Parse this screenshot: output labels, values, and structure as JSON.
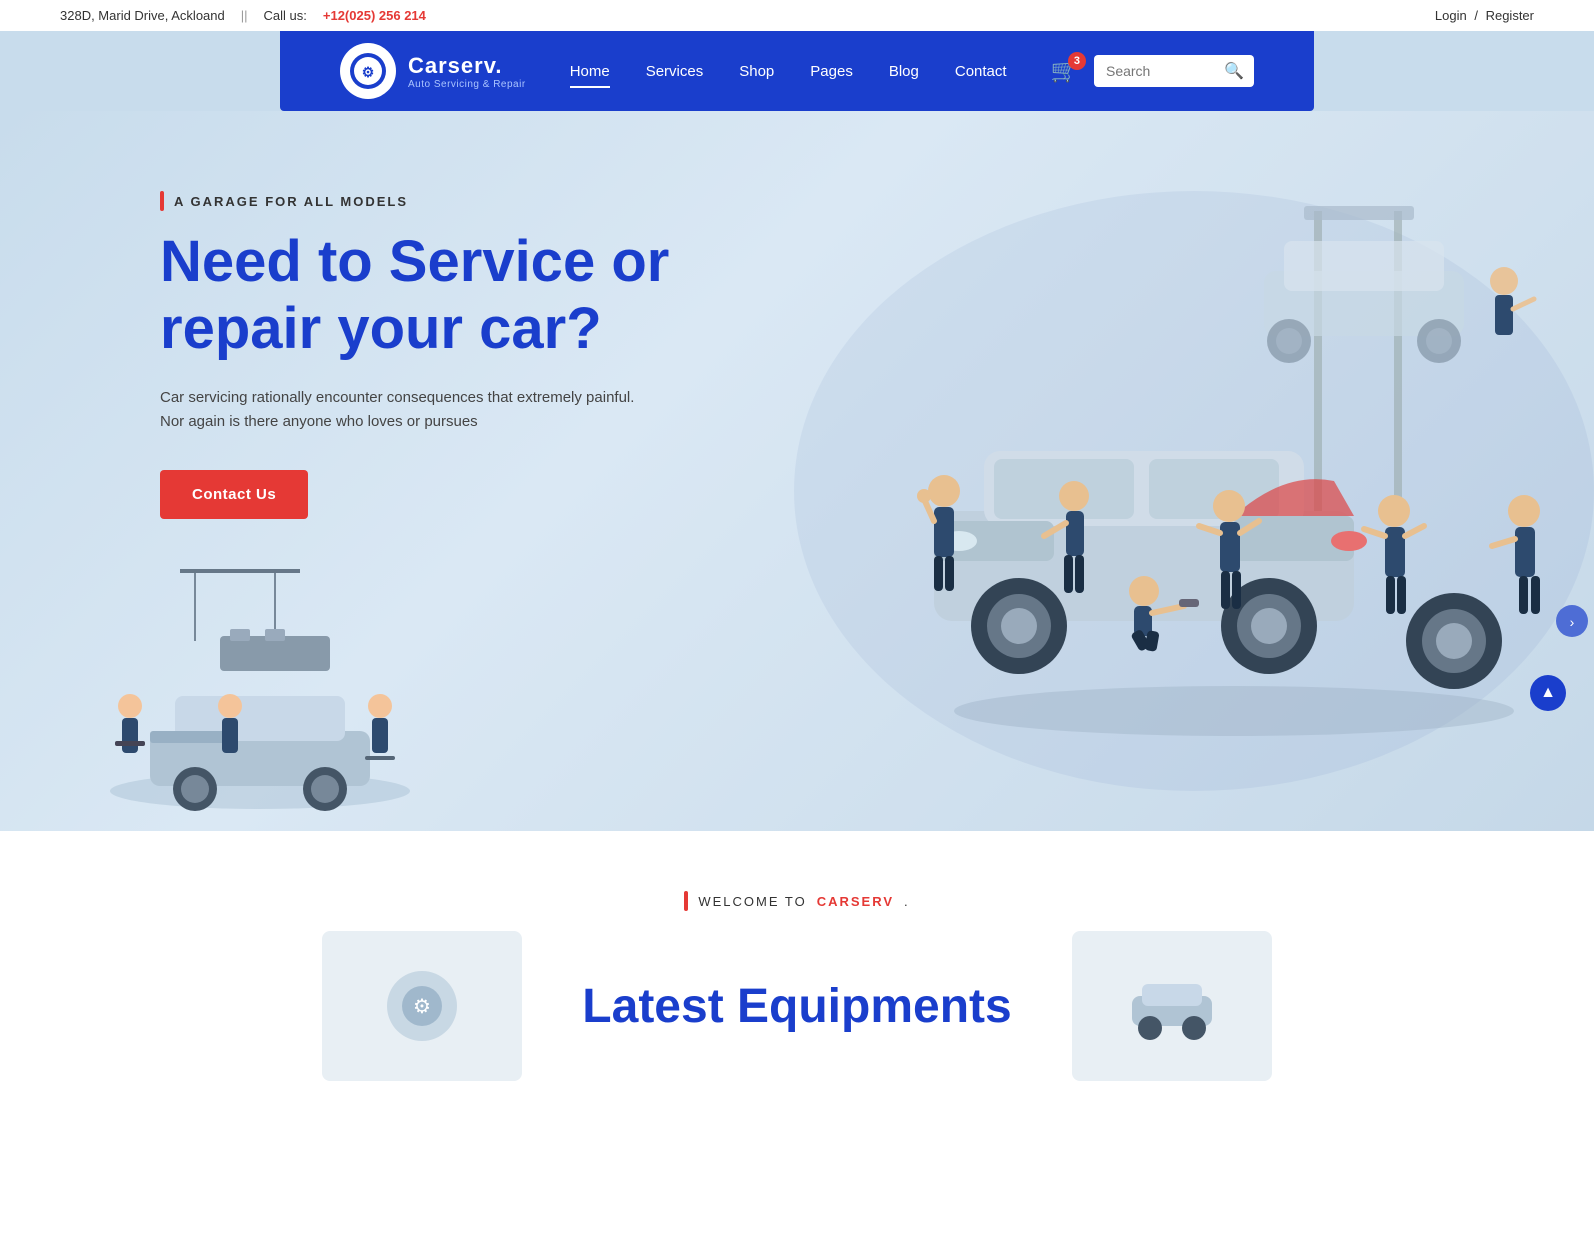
{
  "topbar": {
    "address": "328D, Marid Drive, Ackloand",
    "call_label": "Call us:",
    "phone": "+12(025) 256 214",
    "login": "Login",
    "separator": "/",
    "register": "Register"
  },
  "header": {
    "logo_name": "Carserv.",
    "logo_sub": "Auto Servicing & Repair",
    "nav": [
      {
        "label": "Home",
        "active": true
      },
      {
        "label": "Services",
        "active": false
      },
      {
        "label": "Shop",
        "active": false
      },
      {
        "label": "Pages",
        "active": false
      },
      {
        "label": "Blog",
        "active": false
      },
      {
        "label": "Contact",
        "active": false
      }
    ],
    "cart_count": "3",
    "search_placeholder": "Search"
  },
  "hero": {
    "tag": "A GARAGE FOR ALL MODELS",
    "title_line1": "Need to Service or",
    "title_line2": "repair your car?",
    "description": "Car servicing rationally encounter consequences that extremely painful. Nor again is there anyone who loves or pursues",
    "cta_label": "Contact Us"
  },
  "below_hero": {
    "welcome_label": "WELCOME TO",
    "brand": "CARSERV",
    "brand_period": ".",
    "section_title_line1": "Latest Equipments"
  },
  "colors": {
    "primary": "#1a3ecc",
    "accent": "#e53935",
    "bg_hero": "#c8dcec",
    "bg_white": "#ffffff",
    "text_dark": "#333333",
    "text_body": "#444444"
  }
}
